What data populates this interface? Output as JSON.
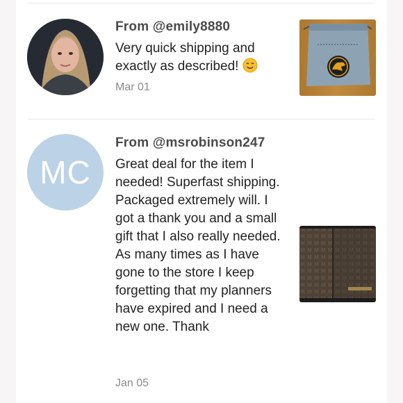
{
  "reviews": [
    {
      "author": "From @emily8880",
      "text": "Very quick shipping and exactly as described! ",
      "emoji": "smiling-face-emoji",
      "date": "Mar 01",
      "avatar_type": "photo",
      "thumbnail": "drawstring-bag-photo"
    },
    {
      "author": "From @msrobinson247",
      "text": "Great deal for the item I needed! Superfast shipping. Packaged extremely will. I got a thank you and a small gift that I also really needed. As many times as I have gone to the store I keep forgetting that my planners have expired and I need a new one. Thank",
      "date": "Jan 05",
      "avatar_type": "initials",
      "avatar_initials": "MC",
      "avatar_color": "#bcd2e6",
      "thumbnail": "planner-wallet-photo"
    }
  ]
}
